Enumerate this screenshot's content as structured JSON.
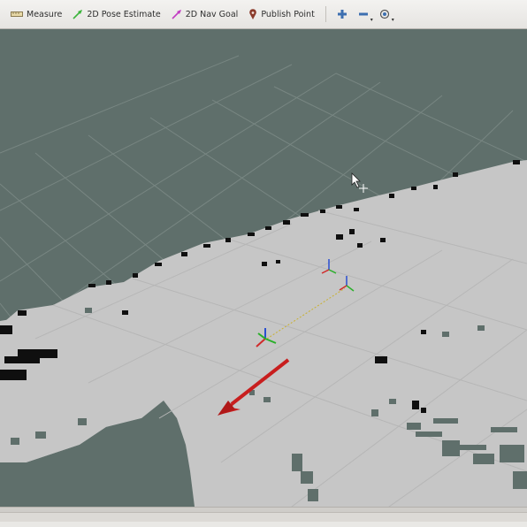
{
  "toolbar": {
    "tools": [
      {
        "label": "Measure",
        "icon": "ruler-icon"
      },
      {
        "label": "2D Pose Estimate",
        "icon": "green-arrow-icon",
        "color": "#3cb43c"
      },
      {
        "label": "2D Nav Goal",
        "icon": "magenta-arrow-icon",
        "color": "#c23cc2"
      },
      {
        "label": "Publish Point",
        "icon": "map-pin-icon",
        "color": "#8a3a2a"
      }
    ],
    "view_controls": [
      "zoom-in-icon",
      "zoom-out-icon",
      "camera-focus-icon"
    ]
  },
  "viewport": {
    "background": "#5f6f6b",
    "free_space_color": "#c6c6c6",
    "unknown_color": "#5f6f6b",
    "occupied_color": "#0f0f0f",
    "goal_arrow_color": "#c81e1e"
  }
}
